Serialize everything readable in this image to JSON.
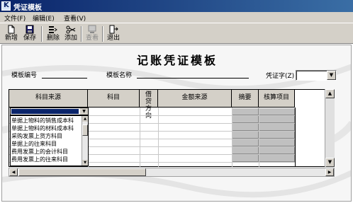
{
  "window": {
    "title": "凭证模板"
  },
  "menu": [
    {
      "label": "文件(F)"
    },
    {
      "label": "编辑(E)"
    },
    {
      "label": "查看(V)"
    }
  ],
  "toolbar": {
    "new_label": "新增",
    "save_label": "保存",
    "delete_label": "删除",
    "add_label": "添加",
    "view_label": "查看",
    "exit_label": "退出"
  },
  "form": {
    "heading": "记账凭证模板",
    "template_no_label": "模板编号",
    "template_name_label": "模板名称",
    "voucher_word_label": "凭证字(Z)",
    "template_no_value": "",
    "template_name_value": "",
    "voucher_word_value": ""
  },
  "grid": {
    "columns": [
      {
        "label": "科目来源"
      },
      {
        "label": "科目"
      },
      {
        "label": "借贷方向"
      },
      {
        "label": "金额来源"
      },
      {
        "label": "摘要"
      },
      {
        "label": "核算项目"
      }
    ]
  },
  "dropdown_options": [
    "单据上物料的销售成本科",
    "单据上物料的材料成本科",
    "采购发票上货方科目",
    "单据上的往来科目",
    "费用发票上的会计科目",
    "费用发票上的往来科目"
  ],
  "colors": {
    "titlebar_start": "#0a246a",
    "titlebar_end": "#3a6ea5",
    "face": "#d4d0c8",
    "selection": "#0a246a"
  }
}
